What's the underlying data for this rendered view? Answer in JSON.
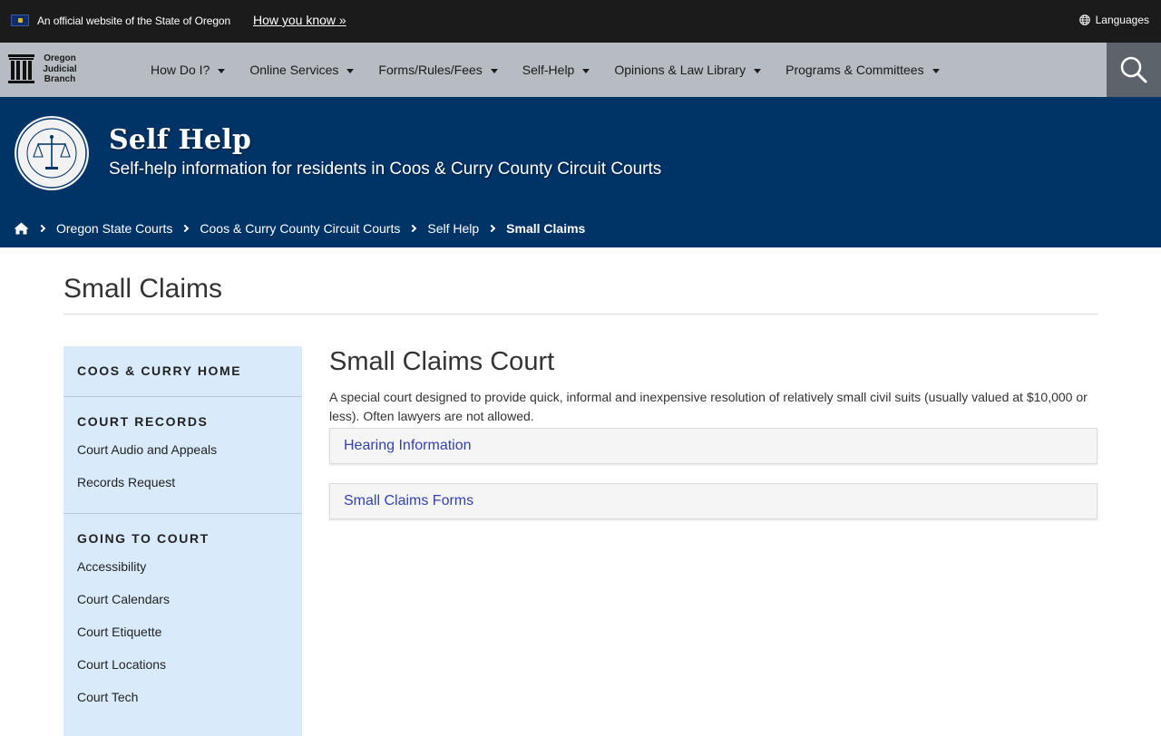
{
  "official_bar": {
    "text": "An official website of the State of Oregon",
    "how_link": "How you know »",
    "languages": "Languages"
  },
  "nav": {
    "logo_lines": [
      "Oregon",
      "Judicial",
      "Branch"
    ],
    "items": [
      {
        "label": "How Do I?"
      },
      {
        "label": "Online Services"
      },
      {
        "label": "Forms/Rules/Fees"
      },
      {
        "label": "Self-Help"
      },
      {
        "label": "Opinions & Law Library"
      },
      {
        "label": "Programs & Committees"
      }
    ],
    "search_icon": "search-icon"
  },
  "hero": {
    "seal_alt": "seal-icon",
    "title": "Self Help",
    "subtitle": "Self-help information for residents in Coos & Curry County Circuit Courts"
  },
  "breadcrumb": [
    {
      "label": "Oregon State Courts"
    },
    {
      "label": "Coos & Curry County Circuit Courts"
    },
    {
      "label": "Self Help"
    },
    {
      "label": "Small Claims"
    }
  ],
  "page": {
    "title": "Small Claims"
  },
  "sidebar": {
    "sections": [
      {
        "heading": "COOS & CURRY HOME",
        "items": []
      },
      {
        "heading": "COURT RECORDS",
        "items": [
          "Court Audio and Appeals",
          "Records Request"
        ]
      },
      {
        "heading": "GOING TO COURT",
        "items": [
          "Accessibility",
          "Court Calendars",
          "Court Etiquette",
          "Court Locations",
          "Court Tech"
        ]
      }
    ]
  },
  "main": {
    "title": "Small Claims Court",
    "description": "A special court designed to provide quick, informal and inexpensive resolution of relatively small civil suits (usually valued at $10,000 or less). Often lawyers are not allowed.",
    "panels": [
      {
        "label": "Hearing Information"
      },
      {
        "label": "Small Claims Forms"
      }
    ]
  },
  "colors": {
    "banner_bg": "#1b1b1b",
    "nav_bg": "#b6bcc2",
    "hero_bg": "#003366",
    "sidebar_bg": "#d9ebfb",
    "link": "#3641b0"
  }
}
